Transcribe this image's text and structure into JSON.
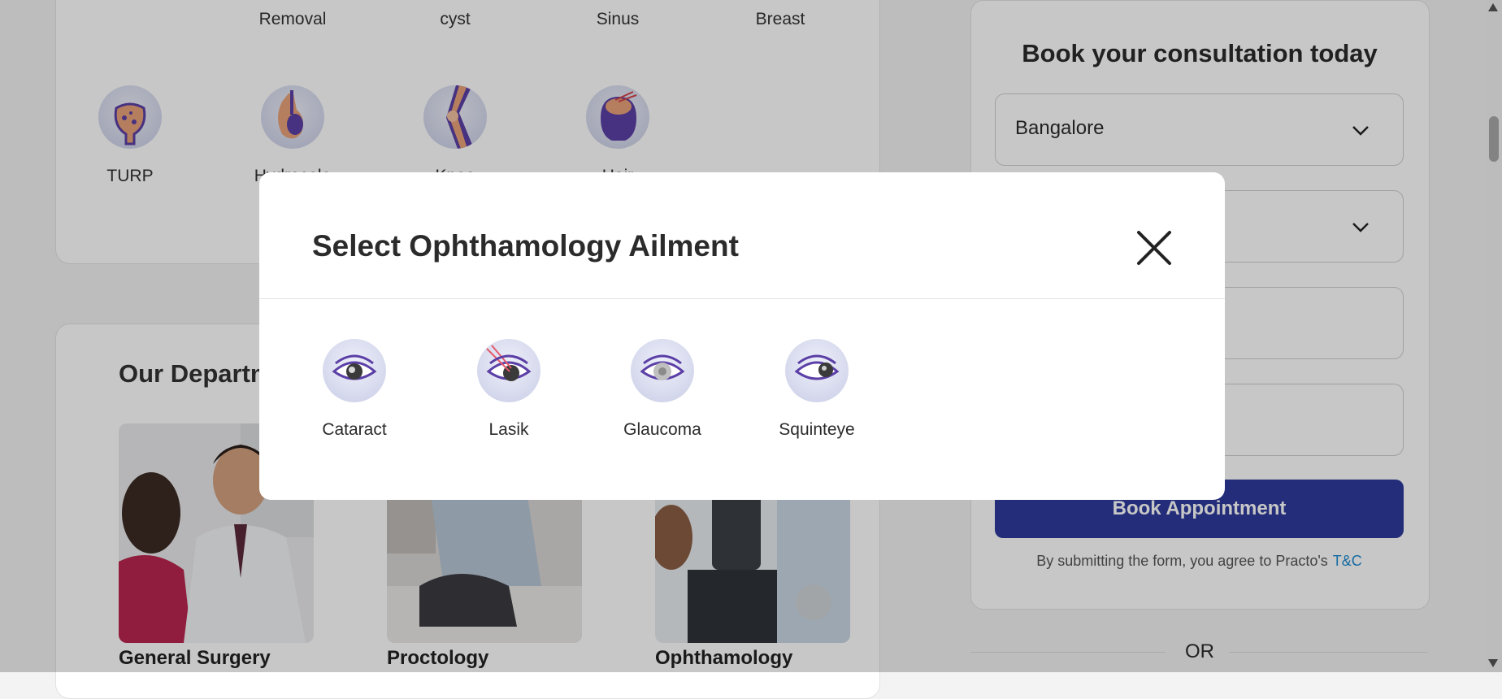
{
  "top_row": [
    "Removal",
    "cyst",
    "Sinus",
    "Breast"
  ],
  "ailments_row2": [
    "TURP",
    "Hydrocele",
    "Knee",
    "Hair"
  ],
  "departments": {
    "title": "Our Departments",
    "items": [
      "General Surgery",
      "Proctology",
      "Ophthamology"
    ]
  },
  "form": {
    "title": "Book your consultation today",
    "city": "Bangalore",
    "book_label": "Book Appointment",
    "terms_text": "By submitting the form, you agree to Practo's",
    "terms_link": "T&C",
    "or_label": "OR"
  },
  "modal": {
    "title": "Select Ophthamology Ailment",
    "items": [
      {
        "label": "Cataract",
        "icon": "cataract-eye-icon"
      },
      {
        "label": "Lasik",
        "icon": "lasik-eye-icon"
      },
      {
        "label": "Glaucoma",
        "icon": "glaucoma-eye-icon"
      },
      {
        "label": "Squinteye",
        "icon": "squint-eye-icon"
      }
    ]
  },
  "colors": {
    "accent": "#2d3a9b",
    "link": "#1a8ad1",
    "icon_purple": "#5b3fa6"
  }
}
